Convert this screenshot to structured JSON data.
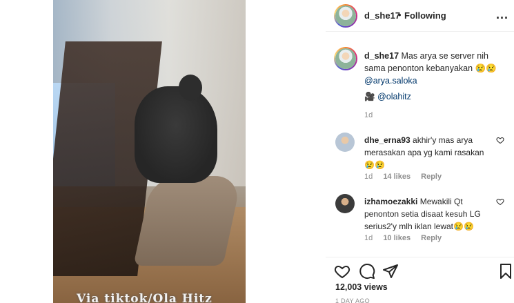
{
  "video": {
    "overlay_text": "Via tiktok/Ola Hitz"
  },
  "header": {
    "username": "d_she17",
    "separator": "•",
    "follow_status": "Following",
    "more_label": "..."
  },
  "caption": {
    "username": "d_she17",
    "text": "Mas arya se server nih sama penonton kebanyakan 😢😢",
    "mention": "@arya.saloka",
    "camera_icon": "🎥",
    "mention2": "@olahitz",
    "time": "1d"
  },
  "comments": [
    {
      "username": "dhe_erna93",
      "text": "akhir'y mas arya merasakan apa yg kami rasakan😢😢",
      "time": "1d",
      "likes": "14 likes",
      "reply": "Reply"
    },
    {
      "username": "izhamoezakki",
      "text": "Mewakili Qt penonton setia disaat kesuh LG serius2'y mlh iklan lewat😢😢",
      "time": "1d",
      "likes": "10 likes",
      "reply": "Reply"
    }
  ],
  "footer": {
    "views": "12,003 views",
    "posted_ago": "1 DAY AGO"
  },
  "icons": {
    "like": "heart-icon",
    "comment": "comment-icon",
    "share": "share-icon",
    "save": "bookmark-icon"
  }
}
